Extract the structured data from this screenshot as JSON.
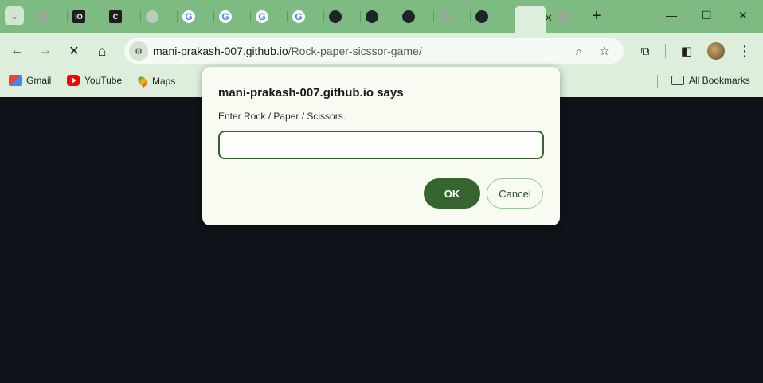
{
  "tabs": {
    "items": [
      {
        "icon": "gray-globe-icon",
        "label": ""
      },
      {
        "icon": "io-logo-icon",
        "label": "IO"
      },
      {
        "icon": "c-logo-icon",
        "label": "C"
      },
      {
        "icon": "chatgpt-icon",
        "label": ""
      },
      {
        "icon": "google-icon",
        "label": "G"
      },
      {
        "icon": "google-icon",
        "label": "G"
      },
      {
        "icon": "google-icon",
        "label": "G"
      },
      {
        "icon": "google-icon",
        "label": "G"
      },
      {
        "icon": "github-icon",
        "label": ""
      },
      {
        "icon": "github-icon",
        "label": ""
      },
      {
        "icon": "github-icon",
        "label": ""
      },
      {
        "icon": "gray-globe-icon",
        "label": ""
      },
      {
        "icon": "github-icon",
        "label": ""
      },
      {
        "icon": "loading-icon",
        "label": "",
        "active": true
      },
      {
        "icon": "gray-globe-icon",
        "label": ""
      }
    ],
    "active_close": "✕",
    "new_tab": "+"
  },
  "window_controls": {
    "minimize": "—",
    "maximize": "☐",
    "close": "✕"
  },
  "toolbar": {
    "back": "←",
    "forward": "→",
    "stop": "✕",
    "home": "⌂",
    "url_domain": "mani-prakash-007.github.io",
    "url_path": "/Rock-paper-sicssor-game/",
    "zoom_icon": "⌕",
    "star_icon": "☆",
    "extensions_icon": "⧉",
    "sidebar_icon": "◧",
    "menu_icon": "⋮"
  },
  "bookmarks": {
    "items": [
      {
        "label": "Gmail"
      },
      {
        "label": "YouTube"
      },
      {
        "label": "Maps"
      }
    ],
    "all_bookmarks": "All Bookmarks"
  },
  "dialog": {
    "title": "mani-prakash-007.github.io says",
    "message": "Enter Rock / Paper / Scissors.",
    "input_value": "",
    "ok_label": "OK",
    "cancel_label": "Cancel"
  },
  "colors": {
    "tabstrip": "#7dbb82",
    "toolbar": "#ddeedd",
    "page_background": "#10121a",
    "ok_button": "#376530"
  }
}
